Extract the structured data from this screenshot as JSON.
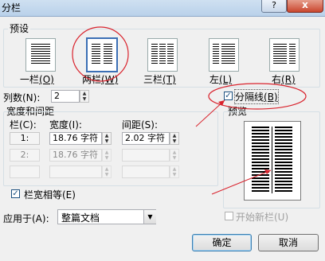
{
  "window": {
    "title": "分栏",
    "help_label": "?",
    "close_label": "x"
  },
  "presets": {
    "group_title": "预设",
    "items": [
      {
        "label": "一栏(O)",
        "text": "一栏",
        "mnemonic": "(O)",
        "selected": false
      },
      {
        "label": "两栏(W)",
        "text": "两栏",
        "mnemonic": "(W)",
        "selected": true
      },
      {
        "label": "三栏(T)",
        "text": "三栏",
        "mnemonic": "(T)",
        "selected": false
      },
      {
        "label": "左(L)",
        "text": "左",
        "mnemonic": "(L)",
        "selected": false
      },
      {
        "label": "右(R)",
        "text": "右",
        "mnemonic": "(R)",
        "selected": false
      }
    ]
  },
  "columns": {
    "label": "列数(N):",
    "value": "2"
  },
  "line_between": {
    "label": "分隔线(B)",
    "text": "分隔线",
    "mnemonic": "(B)",
    "checked": true
  },
  "width_spacing": {
    "group_title": "宽度和间距",
    "col_header": "栏(C):",
    "width_header": "宽度(I):",
    "spacing_header": "间距(S):",
    "rows": [
      {
        "col": "1:",
        "width": "18.76 字符",
        "spacing": "2.02 字符",
        "enabled": true
      },
      {
        "col": "2:",
        "width": "18.76 字符",
        "spacing": "",
        "enabled": false
      },
      {
        "col": "",
        "width": "",
        "spacing": "",
        "enabled": false
      }
    ]
  },
  "preview": {
    "title": "预览"
  },
  "equal_width": {
    "label": "栏宽相等(E)",
    "checked": true
  },
  "apply_to": {
    "label": "应用于(A):",
    "value": "整篇文档"
  },
  "new_column": {
    "label": "开始新栏(U)",
    "checked": false,
    "enabled": false
  },
  "buttons": {
    "ok": "确定",
    "cancel": "取消"
  },
  "annotation_color": "#d9232d"
}
